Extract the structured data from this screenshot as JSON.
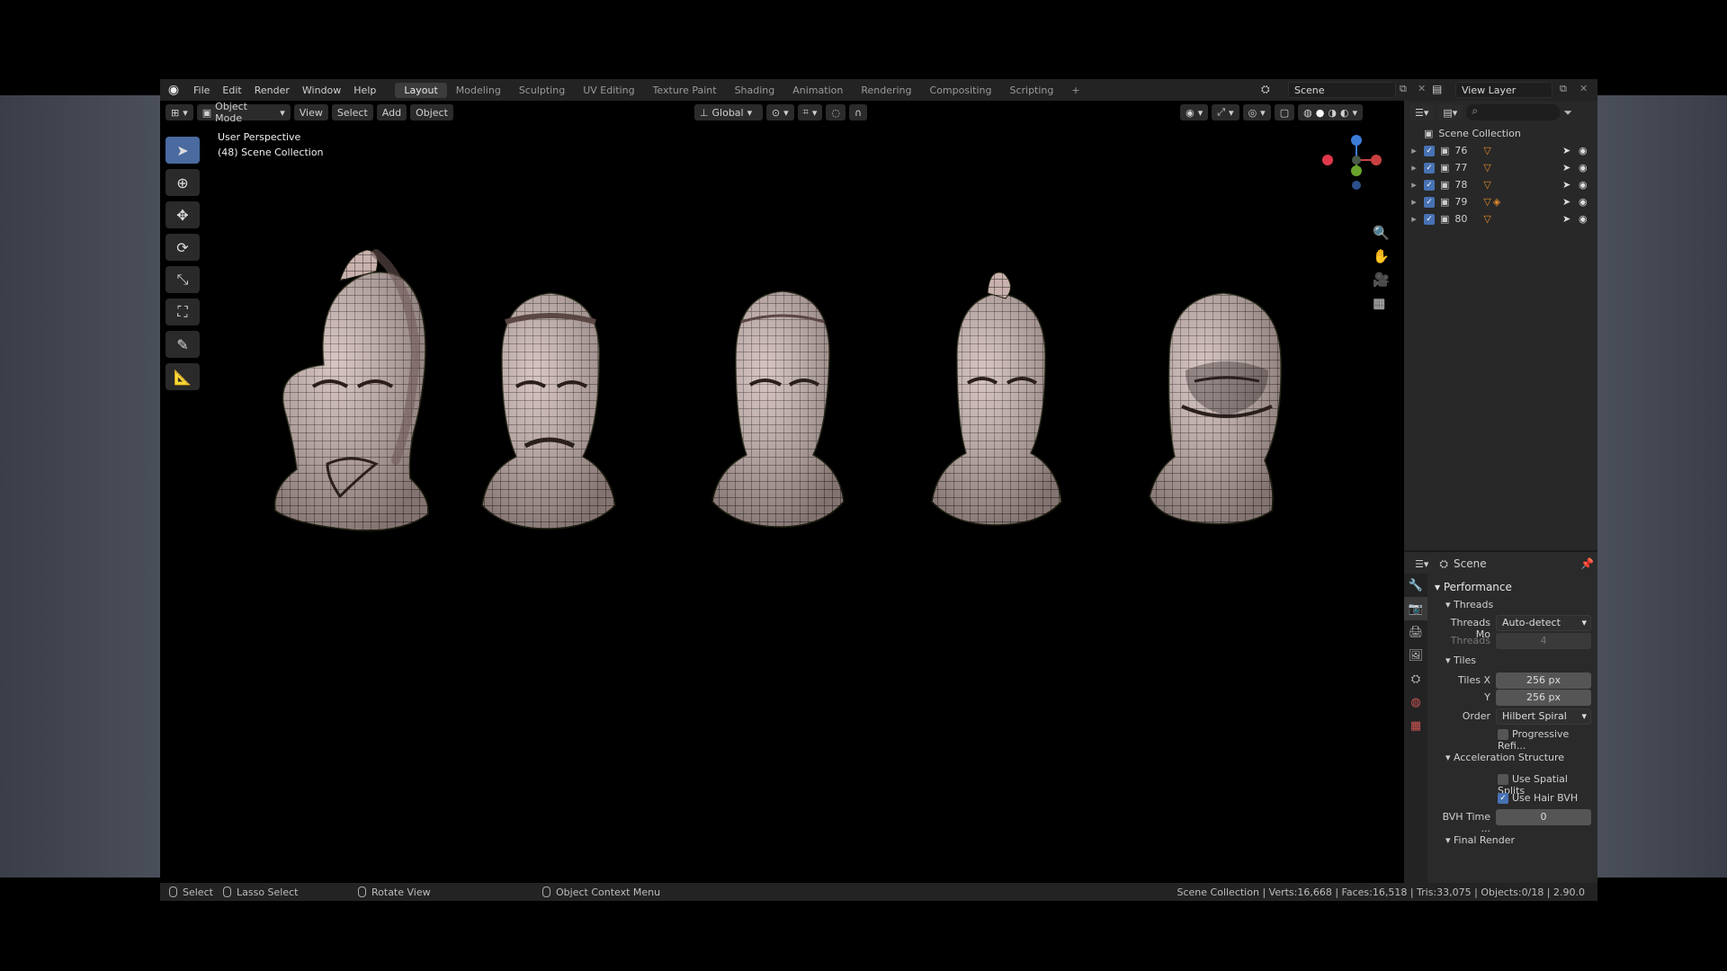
{
  "menubar": {
    "items": [
      "File",
      "Edit",
      "Render",
      "Window",
      "Help"
    ]
  },
  "workspaces": [
    "Layout",
    "Modeling",
    "Sculpting",
    "UV Editing",
    "Texture Paint",
    "Shading",
    "Animation",
    "Rendering",
    "Compositing",
    "Scripting"
  ],
  "active_workspace": "Layout",
  "scene": {
    "name": "Scene",
    "view_layer": "View Layer"
  },
  "viewport_header": {
    "mode": "Object Mode",
    "menus": [
      "View",
      "Select",
      "Add",
      "Object"
    ],
    "orientation": "Global"
  },
  "viewport": {
    "perspective": "User Perspective",
    "collection": "(48) Scene Collection"
  },
  "outliner": {
    "root": "Scene Collection",
    "items": [
      "76",
      "77",
      "78",
      "79",
      "80"
    ]
  },
  "properties": {
    "context": "Scene",
    "sections": {
      "performance": "Performance",
      "threads": "Threads",
      "threads_mode_label": "Threads Mo",
      "threads_mode_value": "Auto-detect",
      "threads_label": "Threads",
      "threads_value": "4",
      "tiles": "Tiles",
      "tiles_x_label": "Tiles X",
      "tiles_x_value": "256 px",
      "tiles_y_label": "Y",
      "tiles_y_value": "256 px",
      "order_label": "Order",
      "order_value": "Hilbert Spiral",
      "progressive": "Progressive Refi...",
      "accel": "Acceleration Structure",
      "spatial_splits": "Use Spatial Splits",
      "hair_bvh": "Use Hair BVH",
      "bvh_time_label": "BVH Time ...",
      "bvh_time_value": "0",
      "final_render": "Final Render"
    }
  },
  "statusbar": {
    "select": "Select",
    "lasso": "Lasso Select",
    "rotate": "Rotate View",
    "context_menu": "Object Context Menu",
    "stats": "Scene Collection | Verts:16,668 | Faces:16,518 | Tris:33,075 | Objects:0/18 | 2.90.0"
  },
  "colors": {
    "accent": "#4772b3",
    "mesh": "#c9b2ae",
    "wire": "#2a2222"
  }
}
